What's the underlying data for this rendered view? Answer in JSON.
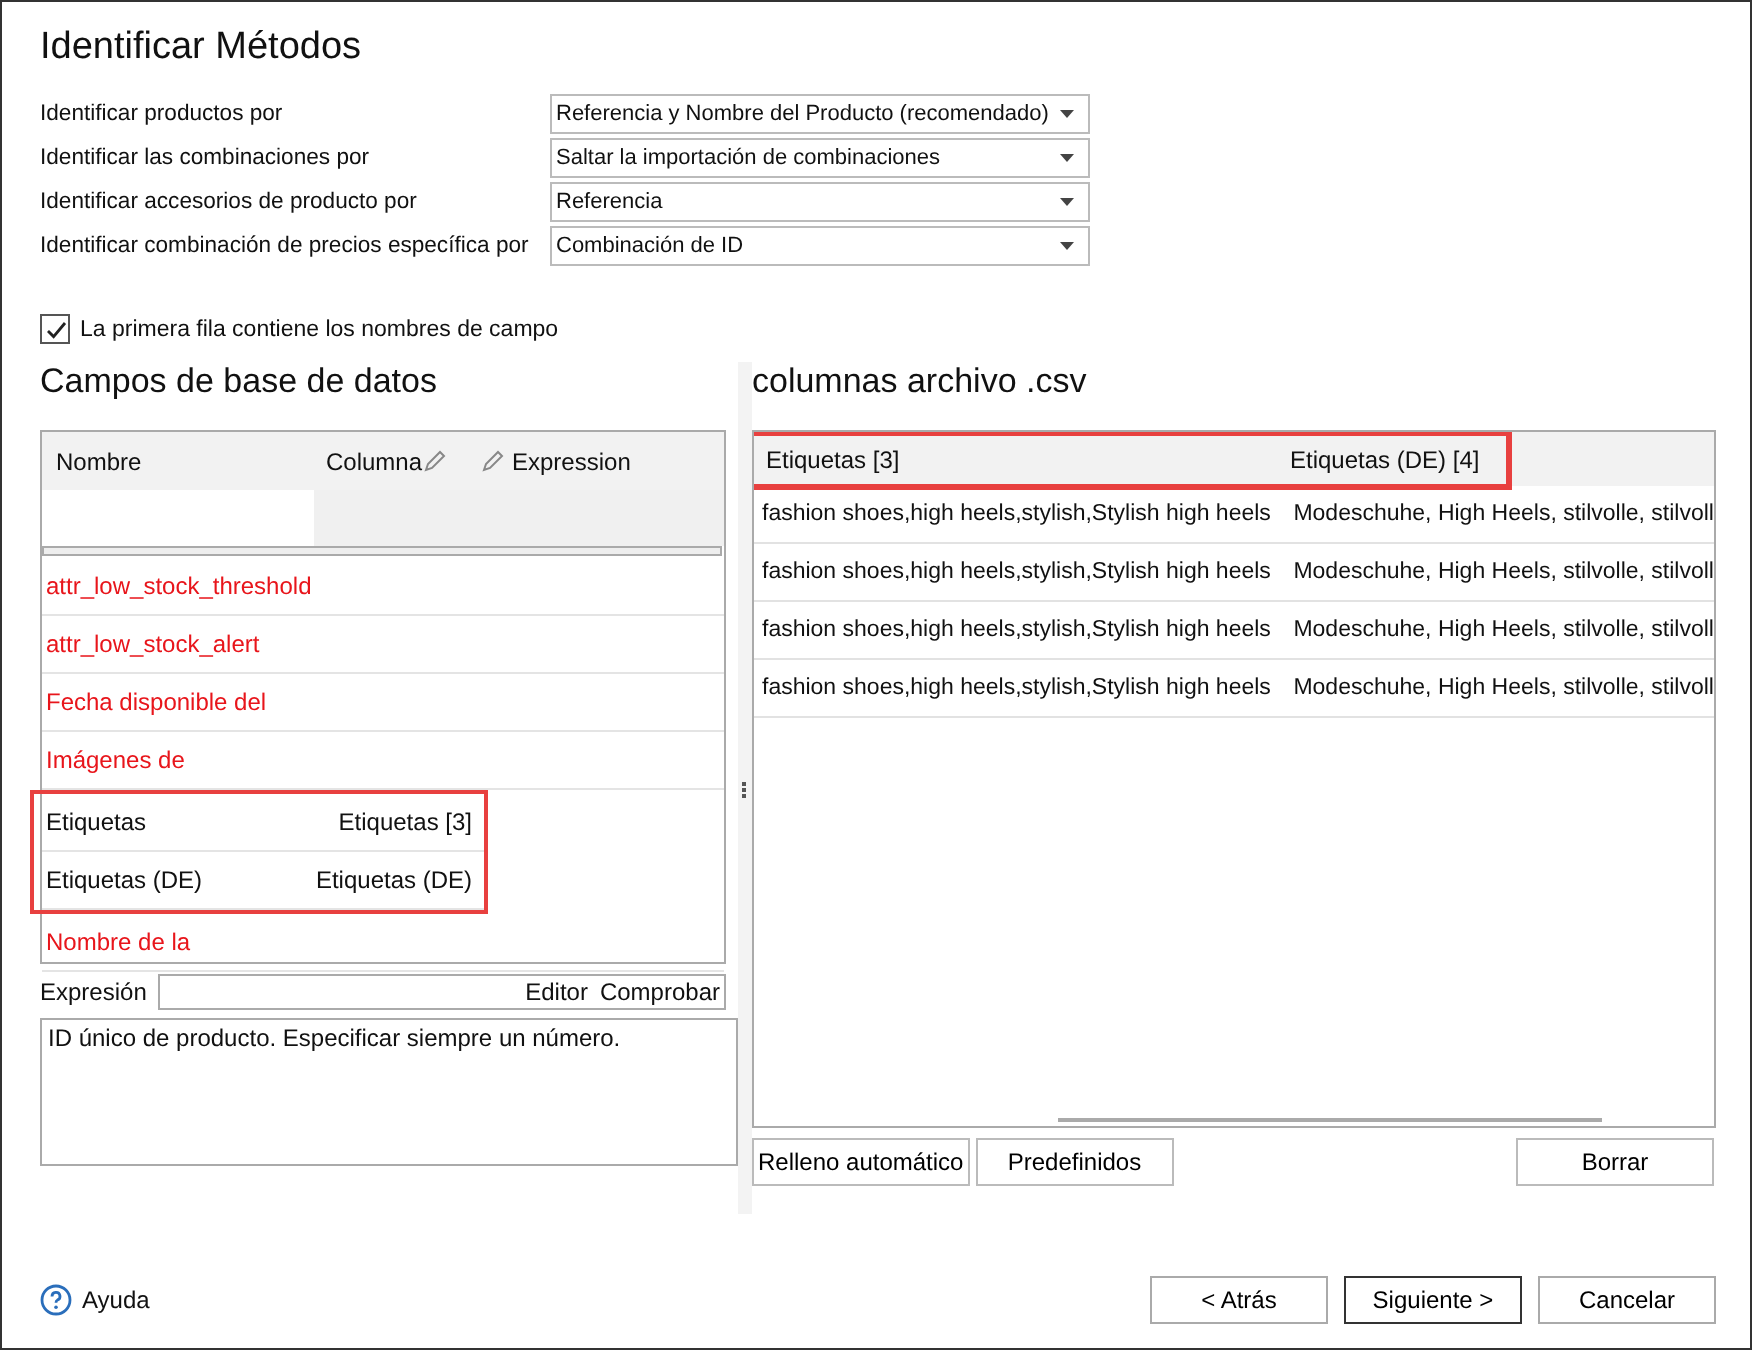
{
  "title": "Identificar Métodos",
  "methods": [
    {
      "label": "Identificar productos por",
      "value": "Referencia y Nombre del Producto (recomendado)"
    },
    {
      "label": "Identificar las combinaciones por",
      "value": "Saltar la importación de combinaciones"
    },
    {
      "label": "Identificar accesorios de producto por",
      "value": "Referencia"
    },
    {
      "label": "Identificar combinación de precios específica por",
      "value": "Combinación de ID"
    }
  ],
  "header_row": {
    "label": "La primera fila contiene los nombres de campo",
    "checked": true
  },
  "db_fields": {
    "title": "Campos de base de datos",
    "columns": [
      "Nombre",
      "Columna",
      "Expression"
    ],
    "rows": [
      {
        "name": "attr_low_stock_threshold",
        "column": "",
        "mapped": false,
        "highlighted": false
      },
      {
        "name": "attr_low_stock_alert",
        "column": "",
        "mapped": false,
        "highlighted": false
      },
      {
        "name": "Fecha disponible del",
        "column": "",
        "mapped": false,
        "highlighted": false
      },
      {
        "name": "Imágenes de",
        "column": "",
        "mapped": false,
        "highlighted": false
      },
      {
        "name": "Etiquetas",
        "column": "Etiquetas [3]",
        "mapped": true,
        "highlighted": true
      },
      {
        "name": "Etiquetas (DE)",
        "column": "Etiquetas (DE)",
        "mapped": true,
        "highlighted": true
      },
      {
        "name": "Nombre de la",
        "column": "",
        "mapped": false,
        "highlighted": false
      }
    ]
  },
  "expression": {
    "label": "Expresión",
    "editor": "Editor",
    "check": "Comprobar",
    "description": "ID único de producto. Especificar siempre un número."
  },
  "csv": {
    "title": "columnas archivo .csv",
    "highlighted": true,
    "columns": [
      "Etiquetas [3]",
      "Etiquetas (DE) [4]"
    ],
    "rows": [
      [
        "fashion shoes,high heels,stylish,Stylish high heels",
        "Modeschuhe, High Heels, stilvolle, stilvoll"
      ],
      [
        "fashion shoes,high heels,stylish,Stylish high heels",
        "Modeschuhe, High Heels, stilvolle, stilvoll"
      ],
      [
        "fashion shoes,high heels,stylish,Stylish high heels",
        "Modeschuhe, High Heels, stilvolle, stilvoll"
      ],
      [
        "fashion shoes,high heels,stylish,Stylish high heels",
        "Modeschuhe, High Heels, stilvolle, stilvoll"
      ]
    ],
    "buttons": [
      "Relleno automático",
      "Predefinidos",
      "Borrar"
    ]
  },
  "help": "Ayuda",
  "nav_buttons": [
    {
      "label": "< Atrás",
      "default": false
    },
    {
      "label": "Siguiente >",
      "default": true
    },
    {
      "label": "Cancelar",
      "default": false
    }
  ]
}
